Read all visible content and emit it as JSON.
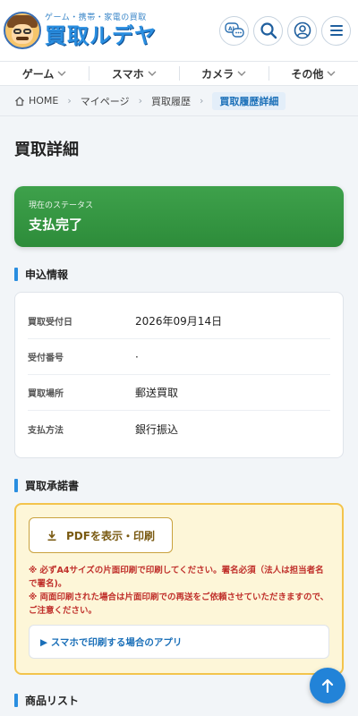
{
  "header": {
    "tagline": "ゲーム・携帯・家電の買取",
    "brand": "買取ルデヤ"
  },
  "nav": {
    "categories": [
      {
        "label": "ゲーム"
      },
      {
        "label": "スマホ"
      },
      {
        "label": "カメラ"
      },
      {
        "label": "その他"
      }
    ]
  },
  "breadcrumb": {
    "home": "HOME",
    "mypage": "マイページ",
    "history": "買取履歴",
    "current": "買取履歴詳細"
  },
  "page": {
    "title": "買取詳細"
  },
  "status": {
    "label": "現在のステータス",
    "value": "支払完了",
    "color": "#339642"
  },
  "application": {
    "section_title": "申込情報",
    "rows": [
      {
        "key": "買取受付日",
        "value": "2026年09月14日"
      },
      {
        "key": "受付番号",
        "value": "·"
      },
      {
        "key": "買取場所",
        "value": "郵送買取"
      },
      {
        "key": "支払方法",
        "value": "銀行振込"
      }
    ]
  },
  "approval": {
    "section_title": "買取承諾書",
    "pdf_button": "PDFを表示・印刷",
    "notice_1": "※ 必ずA4サイズの片面印刷で印刷してください。署名必須（法人は担当者名で署名)。",
    "notice_2": "※ 両面印刷された場合は片面印刷での再送をご依頼させていただきますので、ご注意ください。",
    "app_link": "▶ スマホで印刷する場合のアプリ"
  },
  "products": {
    "section_title": "商品リスト"
  },
  "colors": {
    "accent": "#2a8ee0",
    "status_green": "#339642",
    "notice_red": "#c0302b",
    "approval_bg": "#fdf6d8"
  }
}
